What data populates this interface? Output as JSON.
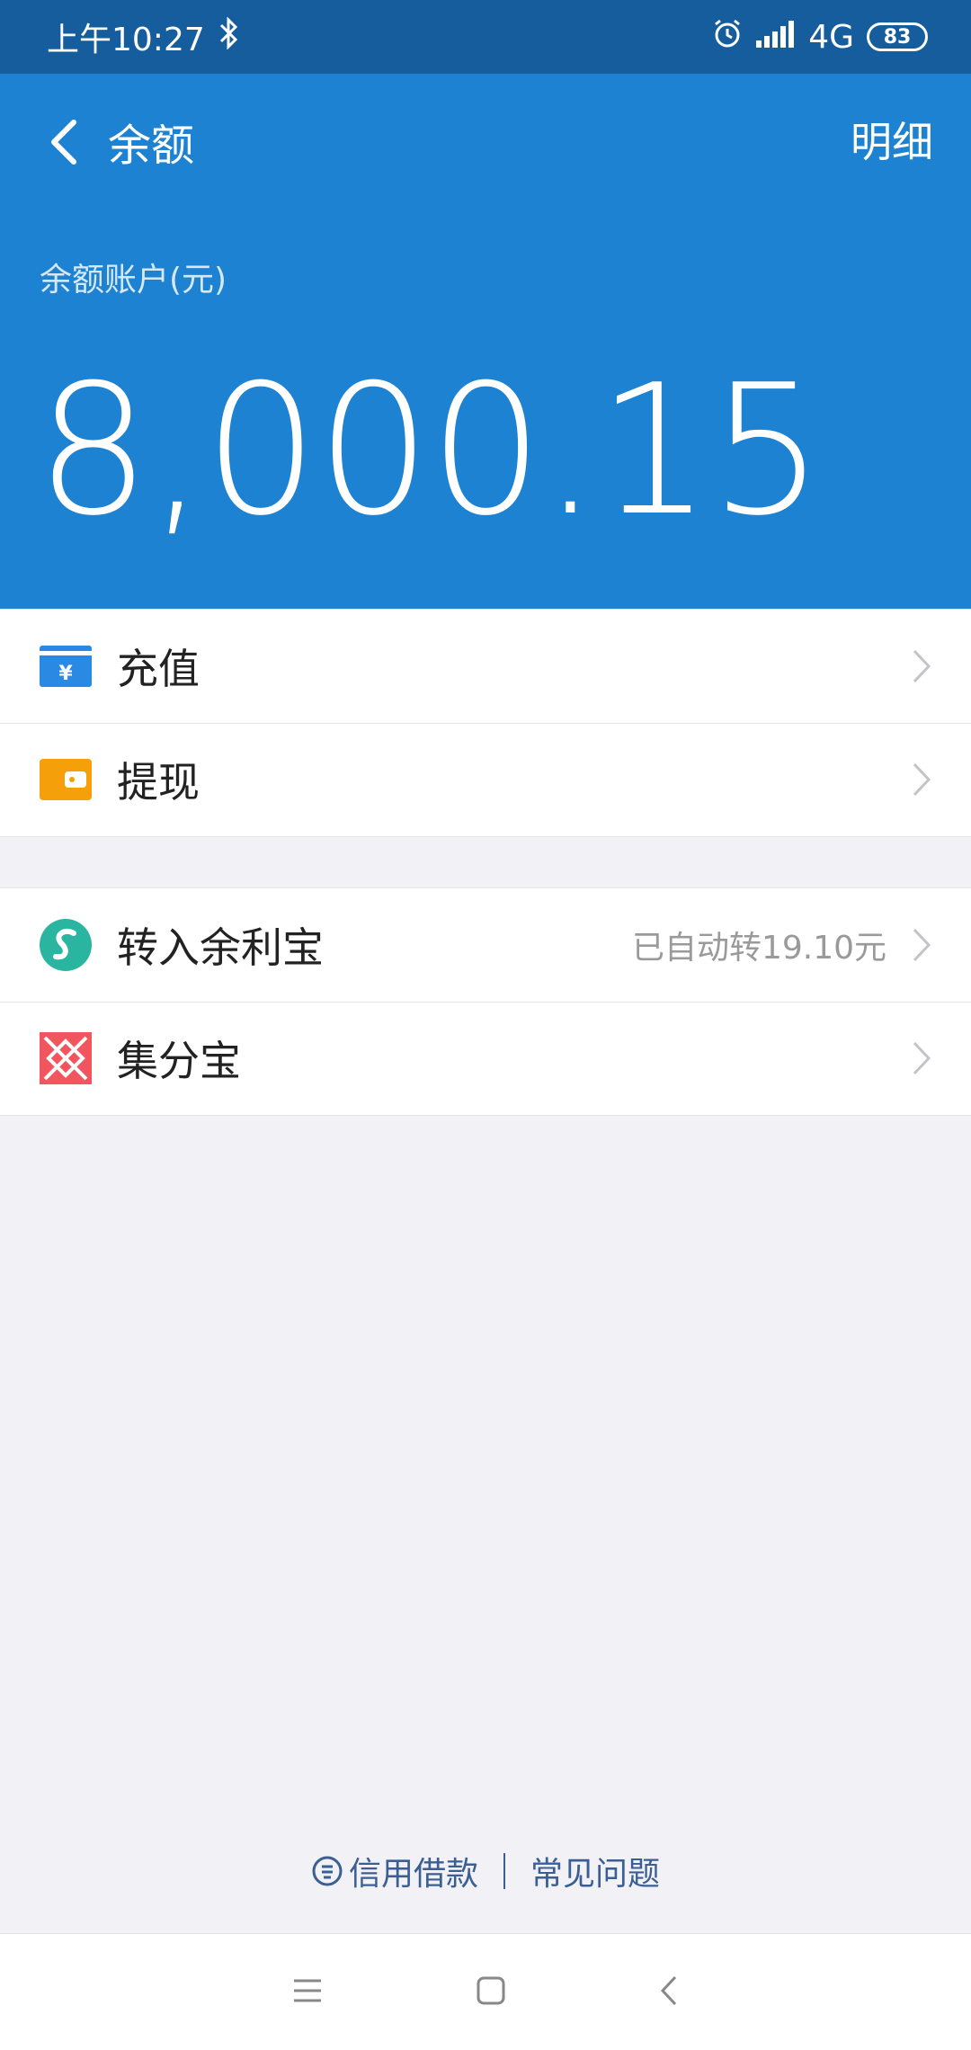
{
  "status_bar": {
    "time": "上午10:27",
    "network": "4G",
    "battery": "83"
  },
  "header": {
    "title": "余额",
    "detail_link": "明细",
    "balance_label": "余额账户(元)",
    "balance_amount": "8,000.15"
  },
  "menu_top": [
    {
      "label": "充值",
      "icon": "recharge-icon",
      "color": "#2a8ae3"
    },
    {
      "label": "提现",
      "icon": "withdraw-icon",
      "color": "#f5a00a"
    }
  ],
  "menu_bottom": [
    {
      "label": "转入余利宝",
      "icon": "yulibao-icon",
      "extra": "已自动转19.10元",
      "color": "#2ab5a0"
    },
    {
      "label": "集分宝",
      "icon": "jifenbao-icon",
      "color": "#f1555d"
    }
  ],
  "footer": {
    "credit_loan": "信用借款",
    "faq": "常见问题"
  },
  "colors": {
    "status_bar": "#155d9c",
    "header": "#1e82d2",
    "background": "#f2f2f6",
    "link": "#3b5f94"
  }
}
